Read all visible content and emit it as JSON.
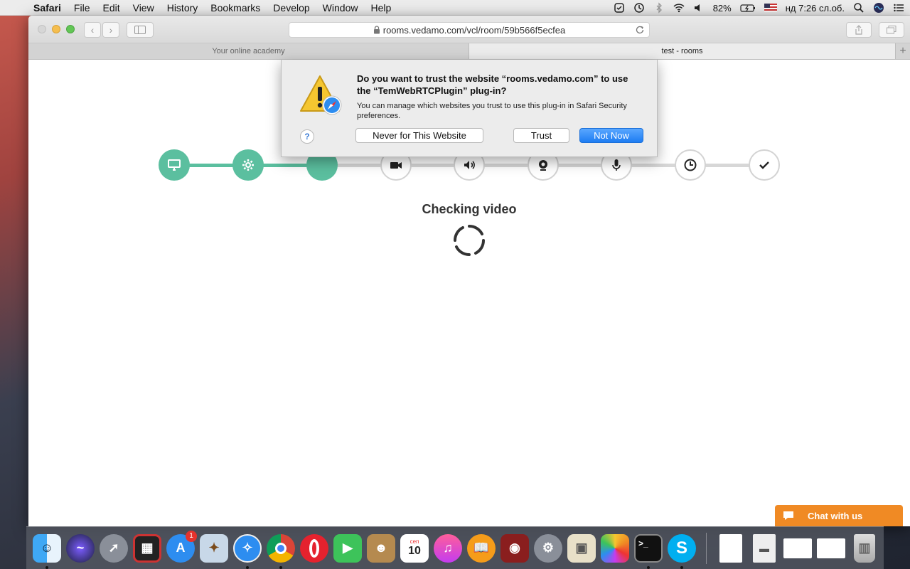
{
  "menubar": {
    "app_name": "Safari",
    "items": [
      "File",
      "Edit",
      "View",
      "History",
      "Bookmarks",
      "Develop",
      "Window",
      "Help"
    ],
    "battery": "82%",
    "clock": "нд 7:26 сл.об."
  },
  "browser": {
    "url": "rooms.vedamo.com/vcl/room/59b566f5ecfea",
    "tabs": [
      {
        "label": "Your online academy",
        "active": false
      },
      {
        "label": "test - rooms",
        "active": true
      }
    ]
  },
  "dialog": {
    "title": "Do you want to trust the website “rooms.vedamo.com” to use the “TemWebRTCPlugin” plug-in?",
    "body": "You can manage which websites you trust to use this plug-in in Safari Security preferences.",
    "help_label": "?",
    "never_label": "Never for This Website",
    "trust_label": "Trust",
    "not_now_label": "Not Now"
  },
  "checker": {
    "title": "Checking video",
    "steps": [
      {
        "icon": "monitor-icon",
        "status": "done"
      },
      {
        "icon": "gear-icon",
        "status": "done"
      },
      {
        "icon": "blank",
        "status": "done"
      },
      {
        "icon": "video-camera-icon",
        "status": "pending"
      },
      {
        "icon": "speaker-icon",
        "status": "pending"
      },
      {
        "icon": "webcam-icon",
        "status": "pending"
      },
      {
        "icon": "microphone-icon",
        "status": "pending"
      },
      {
        "icon": "clock-icon",
        "status": "pending"
      },
      {
        "icon": "checkmark-icon",
        "status": "pending"
      }
    ],
    "accent_color": "#5bbf9f"
  },
  "chat": {
    "label": "Chat with us",
    "color": "#f08a24"
  },
  "dock": {
    "calendar_month": "сеп",
    "calendar_day": "10",
    "app_store_badge": "1"
  }
}
